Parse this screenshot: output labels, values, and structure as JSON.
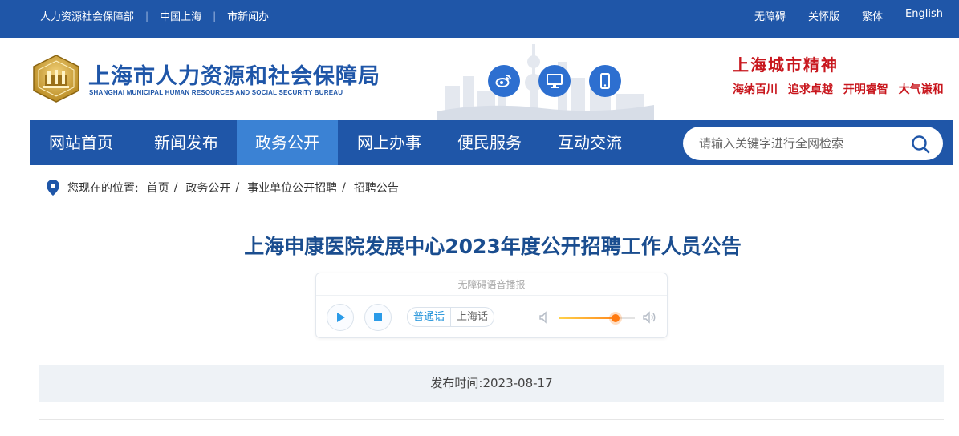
{
  "topbar": {
    "links": [
      "人力资源社会保障部",
      "中国上海",
      "市新闻办"
    ],
    "right": [
      "无障碍",
      "关怀版",
      "繁体",
      "English"
    ]
  },
  "header": {
    "logo_cn": "上海市人力资源和社会保障局",
    "logo_en": "SHANGHAI MUNICIPAL HUMAN RESOURCES AND SOCIAL SECURITY BUREAU",
    "icons": [
      "weibo-icon",
      "desktop-icon",
      "mobile-icon"
    ],
    "spirit_title": "上海城市精神",
    "spirit_items": [
      "海纳百川",
      "追求卓越",
      "开明睿智",
      "大气谦和"
    ]
  },
  "nav": {
    "items": [
      "网站首页",
      "新闻发布",
      "政务公开",
      "网上办事",
      "便民服务",
      "互动交流"
    ],
    "active": "政务公开"
  },
  "search": {
    "placeholder": "请输入关键字进行全网检索"
  },
  "breadcrumb": {
    "label": "您现在的位置:",
    "items": [
      "首页",
      "政务公开",
      "事业单位公开招聘",
      "招聘公告"
    ]
  },
  "article": {
    "title": "上海申康医院发展中心2023年度公开招聘工作人员公告",
    "date_label": "发布时间:",
    "date": "2023-08-17"
  },
  "player": {
    "title": "无障碍语音播报",
    "langs": [
      "普通话",
      "上海话"
    ],
    "volume": 0.75
  },
  "colors": {
    "primary": "#1f56a8",
    "active_tab": "#3b82d4",
    "spirit_red": "#c8161d",
    "title_blue": "#1a4d8f"
  }
}
